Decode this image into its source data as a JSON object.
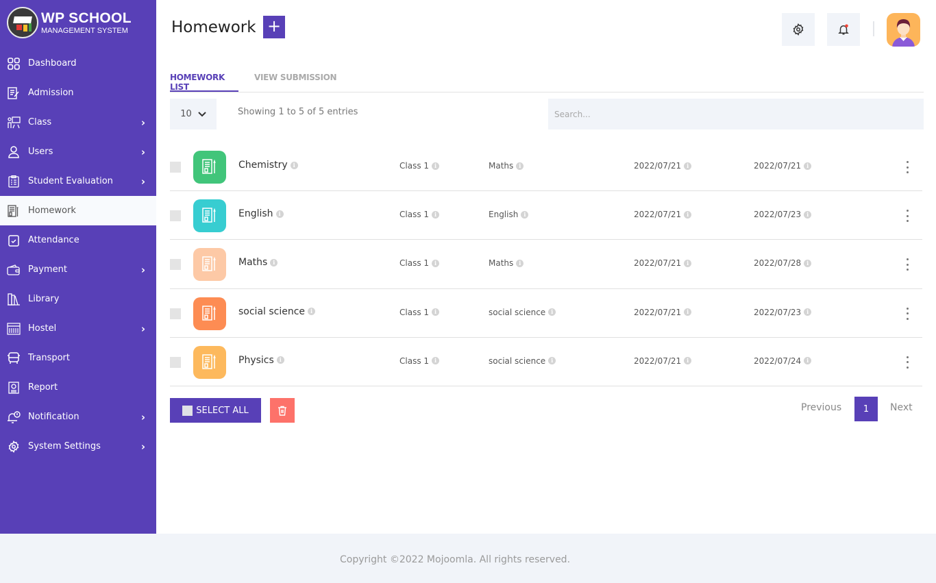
{
  "brand": {
    "title": "WP SCHOOL",
    "subtitle": "MANAGEMENT SYSTEM"
  },
  "sidebar": {
    "items": [
      {
        "label": "Dashboard",
        "icon": "dashboard-grid-icon",
        "has_submenu": false,
        "active": false
      },
      {
        "label": "Admission",
        "icon": "admission-form-icon",
        "has_submenu": false,
        "active": false
      },
      {
        "label": "Class",
        "icon": "class-teacher-icon",
        "has_submenu": true,
        "active": false
      },
      {
        "label": "Users",
        "icon": "user-icon",
        "has_submenu": true,
        "active": false
      },
      {
        "label": "Student Evaluation",
        "icon": "clipboard-icon",
        "has_submenu": true,
        "active": false
      },
      {
        "label": "Homework",
        "icon": "homework-notebook-icon",
        "has_submenu": false,
        "active": true
      },
      {
        "label": "Attendance",
        "icon": "attendance-check-icon",
        "has_submenu": false,
        "active": false
      },
      {
        "label": "Payment",
        "icon": "wallet-icon",
        "has_submenu": true,
        "active": false
      },
      {
        "label": "Library",
        "icon": "books-icon",
        "has_submenu": false,
        "active": false
      },
      {
        "label": "Hostel",
        "icon": "hostel-building-icon",
        "has_submenu": true,
        "active": false
      },
      {
        "label": "Transport",
        "icon": "bus-icon",
        "has_submenu": false,
        "active": false
      },
      {
        "label": "Report",
        "icon": "report-icon",
        "has_submenu": false,
        "active": false
      },
      {
        "label": "Notification",
        "icon": "bell-icon",
        "has_submenu": true,
        "active": false
      },
      {
        "label": "System Settings",
        "icon": "gear-icon",
        "has_submenu": true,
        "active": false
      }
    ]
  },
  "header": {
    "title": "Homework",
    "add_label": "+",
    "settings_icon": "gear-icon",
    "notification_icon": "bell-icon",
    "notification_dot_color": "#f44336",
    "avatar_icon": "user-avatar"
  },
  "tabs": [
    {
      "label": "HOMEWORK LIST",
      "active": true
    },
    {
      "label": "VIEW SUBMISSION",
      "active": false
    }
  ],
  "table_controls": {
    "page_length": "10",
    "showing_text": "Showing 1 to 5 of 5 entries",
    "search_placeholder": "Search..."
  },
  "rows": [
    {
      "title": "Chemistry",
      "class": "Class 1",
      "subject": "Maths",
      "start_date": "2022/07/21",
      "end_date": "2022/07/21",
      "icon_color": "#41c57a"
    },
    {
      "title": "English",
      "class": "Class 1",
      "subject": "English",
      "start_date": "2022/07/21",
      "end_date": "2022/07/23",
      "icon_color": "#37cdd1"
    },
    {
      "title": "Maths",
      "class": "Class 1",
      "subject": "Maths",
      "start_date": "2022/07/21",
      "end_date": "2022/07/28",
      "icon_color": "#fdc9a6"
    },
    {
      "title": "social science",
      "class": "Class 1",
      "subject": "social science",
      "start_date": "2022/07/21",
      "end_date": "2022/07/23",
      "icon_color": "#fd8c53"
    },
    {
      "title": "Physics",
      "class": "Class 1",
      "subject": "social science",
      "start_date": "2022/07/21",
      "end_date": "2022/07/24",
      "icon_color": "#fdb95d"
    }
  ],
  "actions": {
    "select_all_label": "SELECT ALL",
    "delete_icon": "trash-icon"
  },
  "pagination": {
    "previous": "Previous",
    "current": "1",
    "next": "Next"
  },
  "footer": {
    "text": "Copyright ©2022 Mojoomla. All rights reserved."
  },
  "colors": {
    "primary": "#5840b7",
    "danger": "#fd726a",
    "panel": "#f1f4f9"
  }
}
